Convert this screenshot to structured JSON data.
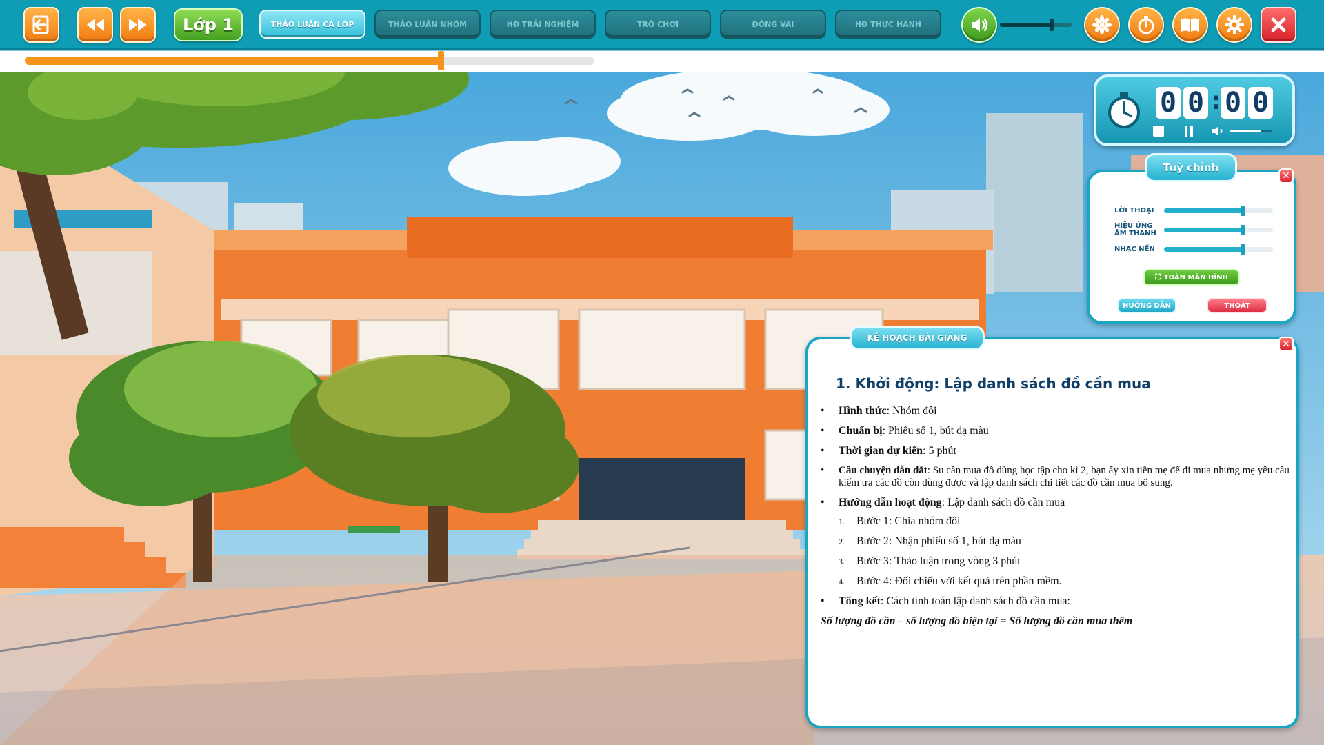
{
  "toolbar": {
    "class_label": "Lớp 1",
    "tabs": [
      {
        "label": "Thảo luận cả lớp",
        "active": true
      },
      {
        "label": "Thảo luận nhóm",
        "active": false
      },
      {
        "label": "HĐ Trải nghiệm",
        "active": false
      },
      {
        "label": "Trò chơi",
        "active": false
      },
      {
        "label": "Đóng vai",
        "active": false
      },
      {
        "label": "HĐ thực hành",
        "active": false
      }
    ],
    "volume_level": 0.72,
    "icons": [
      "exit-icon",
      "rewind-icon",
      "fast-forward-icon",
      "speaker-icon",
      "flower-icon",
      "stopwatch-icon",
      "book-icon",
      "gear-icon",
      "close-icon"
    ]
  },
  "lesson_progress": 0.73,
  "timer": {
    "minutes": "00",
    "seconds": "00",
    "volume_level": 0.75
  },
  "settings": {
    "title": "Tuỳ chỉnh",
    "sliders": [
      {
        "label": "LỜI THOẠI",
        "level": 0.72
      },
      {
        "label": "HIỆU ỨNG ÂM THANH",
        "level": 0.72
      },
      {
        "label": "NHẠC NỀN",
        "level": 0.72
      }
    ],
    "fullscreen_label": "TOÀN MÀN HÌNH",
    "guide_label": "HƯỚNG DẪN",
    "exit_label": "THOÁT"
  },
  "lesson_plan": {
    "title": "KẾ HOẠCH BÀI GIẢNG",
    "heading": "1. Khởi động: Lập danh sách đồ cần mua",
    "items": [
      {
        "term": "Hình thức",
        "text": ": Nhóm đôi"
      },
      {
        "term": "Chuẩn bị",
        "text": ": Phiếu số 1, bút dạ màu"
      },
      {
        "term": "Thời gian dự kiến",
        "text": ": 5 phút"
      },
      {
        "term": "Câu chuyện dẫn dắt",
        "text": ": Su cần mua đồ dùng học tập cho kì 2, bạn ấy xin tiền mẹ để đi mua nhưng mẹ yêu cầu kiểm tra các đồ còn dùng được và lập danh sách chi tiết các đồ cần mua bổ sung."
      },
      {
        "term": "Hướng dẫn hoạt động",
        "text": ": Lập danh sách đồ cần mua"
      }
    ],
    "steps": [
      {
        "n": "1.",
        "text": "Bước 1: Chia nhóm đôi"
      },
      {
        "n": "2.",
        "text": "Bước 2: Nhận phiếu số 1, bút dạ màu"
      },
      {
        "n": "3.",
        "text": "Bước 3: Thảo luận trong vòng 3 phút"
      },
      {
        "n": "4.",
        "text": "Bước 4: Đối chiếu với kết quả trên phần mềm."
      }
    ],
    "summary": {
      "term": "Tổng kết",
      "text": ": Cách tính toán lập danh sách đồ cần mua:"
    },
    "formula": "Số lượng đồ cần – số lượng đồ hiện tại = Số lượng đồ cần mua thêm"
  },
  "colors": {
    "toolbar": "#0e9db5",
    "accent_orange": "#f7941d",
    "panel_border": "#1aa6c3",
    "heading_text": "#103f6a"
  }
}
